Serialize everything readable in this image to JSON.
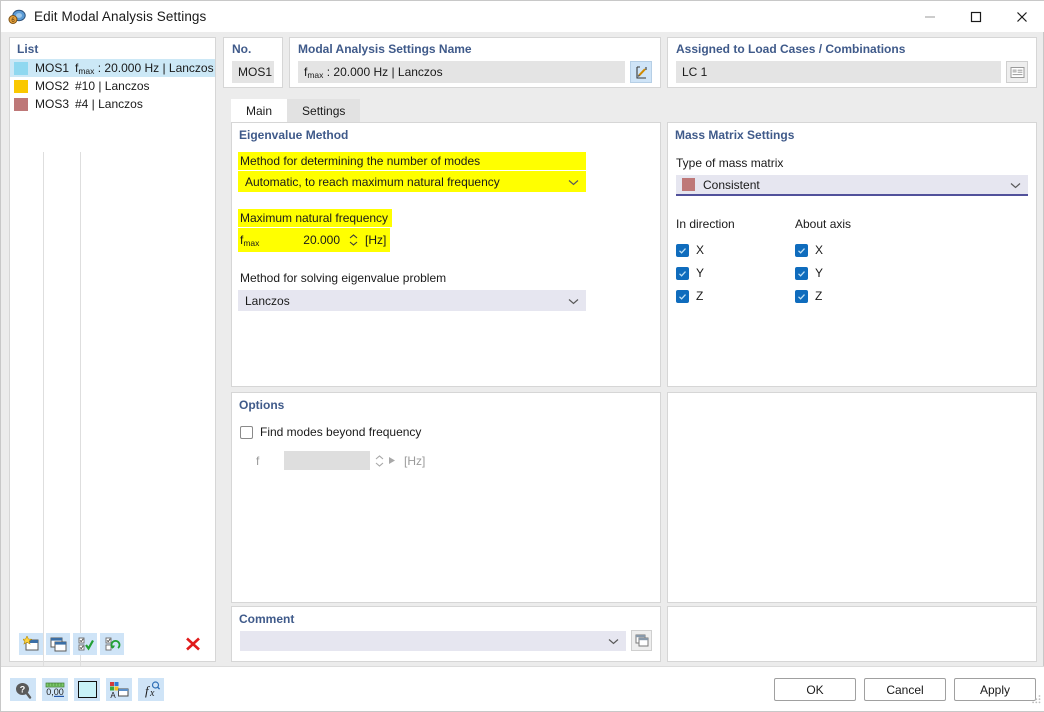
{
  "window": {
    "title": "Edit Modal Analysis Settings",
    "icon": "modal-analysis-icon",
    "minimize": "minimize-icon",
    "maximize": "maximize-icon",
    "close": "close-icon"
  },
  "list": {
    "title": "List",
    "items": [
      {
        "color": "#8fd8f0",
        "no": "MOS1",
        "desc_pre": "f",
        "desc_sub": "max",
        "desc_post": " : 20.000 Hz | Lanczos",
        "selected": true
      },
      {
        "color": "#fac800",
        "no": "MOS2",
        "desc_pre": "",
        "desc_sub": "",
        "desc_post": "#10 | Lanczos",
        "selected": false
      },
      {
        "color": "#be7878",
        "no": "MOS3",
        "desc_pre": "",
        "desc_sub": "",
        "desc_post": "#4 | Lanczos",
        "selected": false
      }
    ],
    "toolbar": [
      {
        "name": "new-item-button"
      },
      {
        "name": "copy-item-button"
      },
      {
        "name": "select-all-button"
      },
      {
        "name": "invert-selection-button"
      },
      {
        "name": "delete-item-button"
      }
    ]
  },
  "header": {
    "no_label": "No.",
    "no_value": "MOS1",
    "name_label": "Modal Analysis Settings Name",
    "name_pre": "f",
    "name_sub": "max",
    "name_post": " : 20.000 Hz | Lanczos",
    "name_edit_button": "edit-name-button",
    "assigned_label": "Assigned to Load Cases / Combinations",
    "assigned_value": "LC 1",
    "assigned_button": "assigned-list-button"
  },
  "tabs": [
    {
      "label": "Main",
      "active": true
    },
    {
      "label": "Settings",
      "active": false
    }
  ],
  "eigenvalue": {
    "title": "Eigenvalue Method",
    "method_modes_label": "Method for determining the number of modes",
    "method_modes_value": "Automatic, to reach maximum natural frequency",
    "max_freq_label": "Maximum natural frequency",
    "fmax_symbol_pre": "f",
    "fmax_symbol_sub": "max",
    "fmax_value": "20.000",
    "fmax_unit": "[Hz]",
    "solver_label": "Method for solving eigenvalue problem",
    "solver_value": "Lanczos"
  },
  "mass_matrix": {
    "title": "Mass Matrix Settings",
    "type_label": "Type of mass matrix",
    "type_value": "Consistent",
    "type_color": "#be7878",
    "in_direction_label": "In direction",
    "about_axis_label": "About axis",
    "in_direction": [
      {
        "label": "X",
        "checked": true
      },
      {
        "label": "Y",
        "checked": true
      },
      {
        "label": "Z",
        "checked": true
      }
    ],
    "about_axis": [
      {
        "label": "X",
        "checked": true
      },
      {
        "label": "Y",
        "checked": true
      },
      {
        "label": "Z",
        "checked": true
      }
    ]
  },
  "options": {
    "title": "Options",
    "find_modes_label": "Find modes beyond frequency",
    "find_modes_checked": false,
    "f_symbol": "f",
    "f_value": "",
    "f_unit": "[Hz]"
  },
  "comment": {
    "title": "Comment",
    "value": "",
    "button": "comment-library-button"
  },
  "footer": {
    "tools": [
      {
        "name": "help-button"
      },
      {
        "name": "decimal-places-button"
      },
      {
        "name": "color-swatch-button",
        "color": "#c8f2f8"
      },
      {
        "name": "display-properties-button"
      },
      {
        "name": "formula-button"
      }
    ],
    "ok": "OK",
    "cancel": "Cancel",
    "apply": "Apply"
  },
  "colors": {
    "header_label": "#3f5a8a",
    "highlight": "#ffff00",
    "accent_underline": "#51519b",
    "selection": "#cce8f6"
  }
}
